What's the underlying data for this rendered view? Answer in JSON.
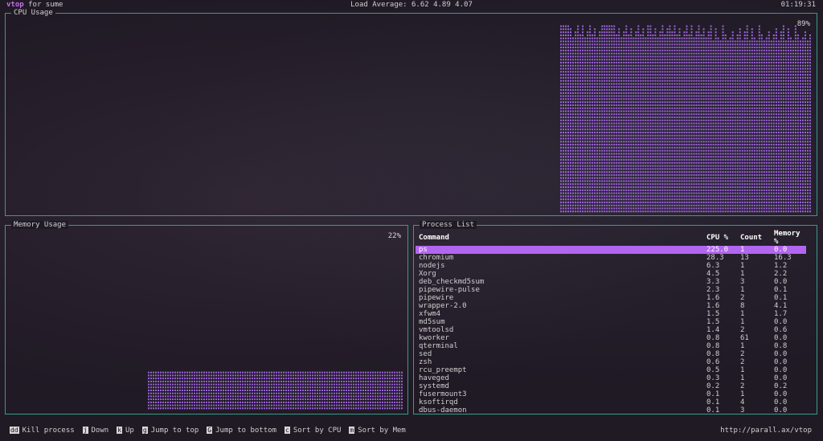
{
  "header": {
    "app_name": "vtop",
    "title_suffix": "for sume",
    "load_average": "Load Average: 6.62 4.89 4.07",
    "time": "01:19:31"
  },
  "cpu_panel": {
    "title": "CPU Usage",
    "percent": "89%"
  },
  "memory_panel": {
    "title": "Memory Usage",
    "percent": "22%"
  },
  "process_panel": {
    "title": "Process List",
    "columns": [
      "Command",
      "CPU %",
      "Count",
      "Memory %"
    ],
    "rows": [
      [
        "ps",
        "225.0",
        "1",
        "0.0"
      ],
      [
        "chromium",
        "28.3",
        "13",
        "16.3"
      ],
      [
        "nodejs",
        "6.3",
        "1",
        "1.2"
      ],
      [
        "Xorg",
        "4.5",
        "1",
        "2.2"
      ],
      [
        "deb_checkmd5sum",
        "3.3",
        "3",
        "0.0"
      ],
      [
        "pipewire-pulse",
        "2.3",
        "1",
        "0.1"
      ],
      [
        "pipewire",
        "1.6",
        "2",
        "0.1"
      ],
      [
        "wrapper-2.0",
        "1.6",
        "8",
        "4.1"
      ],
      [
        "xfwm4",
        "1.5",
        "1",
        "1.7"
      ],
      [
        "md5sum",
        "1.5",
        "1",
        "0.0"
      ],
      [
        "vmtoolsd",
        "1.4",
        "2",
        "0.6"
      ],
      [
        "kworker",
        "0.8",
        "61",
        "0.0"
      ],
      [
        "qterminal",
        "0.8",
        "1",
        "0.8"
      ],
      [
        "sed",
        "0.8",
        "2",
        "0.0"
      ],
      [
        "zsh",
        "0.6",
        "2",
        "0.0"
      ],
      [
        "rcu_preempt",
        "0.5",
        "1",
        "0.0"
      ],
      [
        "haveged",
        "0.3",
        "1",
        "0.0"
      ],
      [
        "systemd",
        "0.2",
        "2",
        "0.2"
      ],
      [
        "fusermount3",
        "0.1",
        "1",
        "0.0"
      ],
      [
        "ksoftirqd",
        "0.1",
        "4",
        "0.0"
      ],
      [
        "dbus-daemon",
        "0.1",
        "3",
        "0.0"
      ]
    ]
  },
  "footer": {
    "items": [
      {
        "key": "dd",
        "label": "Kill process"
      },
      {
        "key": "j",
        "label": "Down"
      },
      {
        "key": "k",
        "label": "Up"
      },
      {
        "key": "g",
        "label": "Jump to top"
      },
      {
        "key": "G",
        "label": "Jump to bottom"
      },
      {
        "key": "c",
        "label": "Sort by CPU"
      },
      {
        "key": "m",
        "label": "Sort by Mem"
      }
    ],
    "url": "http://parall.ax/vtop"
  },
  "colors": {
    "accent": "#b266f0",
    "panel_border": "#3a9a88",
    "graph": "#9a62d8"
  }
}
